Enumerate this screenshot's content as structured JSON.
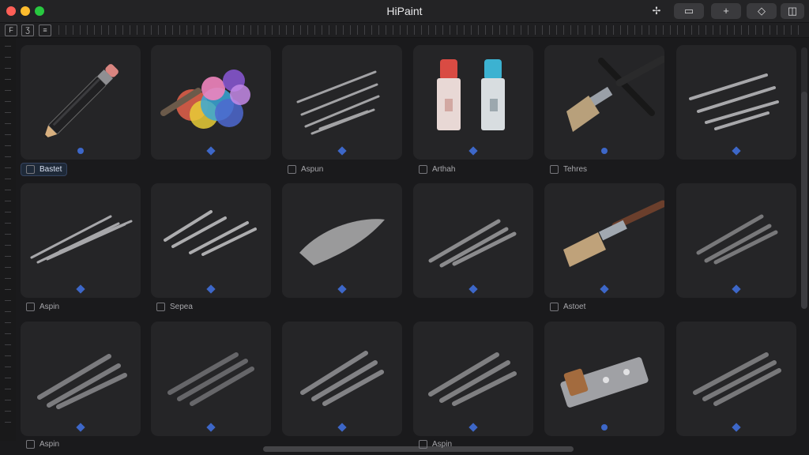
{
  "window": {
    "title": "HiPaint"
  },
  "toolbar": {
    "icons": [
      "pin-icon",
      "comment-icon",
      "plus-icon",
      "shape-icon",
      "panel-icon"
    ],
    "labels": [
      "✢",
      "▭",
      "+",
      "◇",
      "◫"
    ]
  },
  "ruler": {
    "left_tools": [
      "ruler-tool-icon",
      "text-tool-icon",
      "layer-tool-icon"
    ],
    "left_tool_glyphs": [
      "F",
      "Ʒ",
      "≡"
    ]
  },
  "brushes": {
    "captions": {
      "first_row": [
        "Bastet",
        "Aspun",
        "Arthah",
        "Tehres"
      ],
      "second_row": [
        "Aspin",
        "Sepea",
        "Astoet"
      ],
      "third_row": [
        "Aspin",
        "Aspin"
      ]
    }
  },
  "colors": {
    "accent": "#3d67c8",
    "tile": "#252527",
    "background": "#1a1a1c"
  }
}
